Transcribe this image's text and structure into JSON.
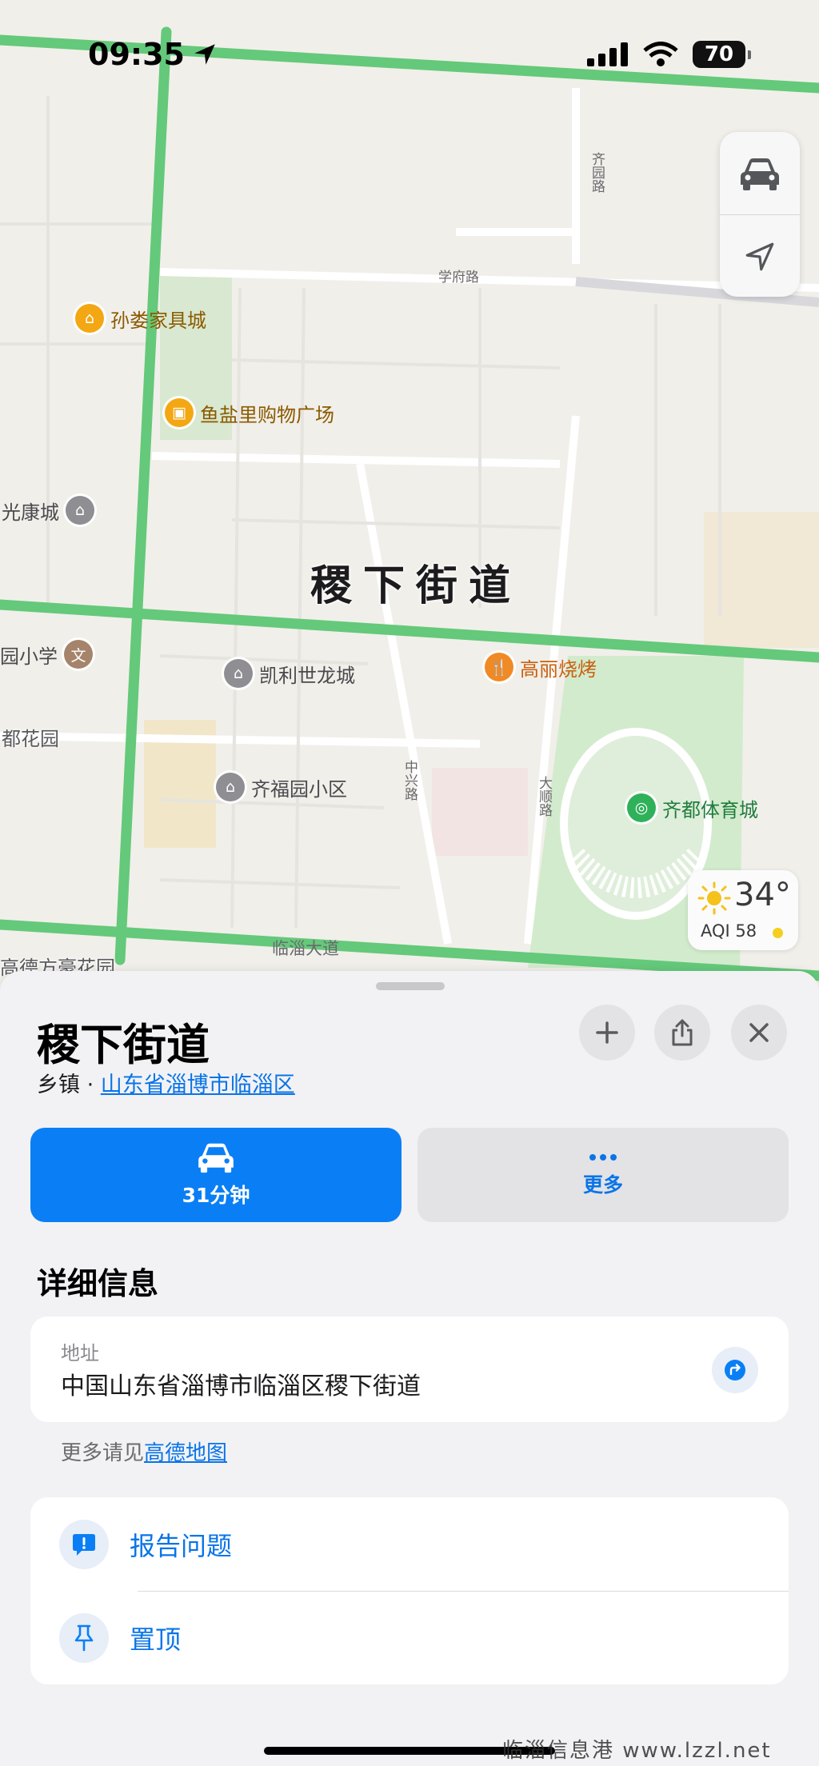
{
  "status_bar": {
    "time": "09:35",
    "battery": "70"
  },
  "map": {
    "district_label": "稷下街道",
    "pois": [
      {
        "name": "孙娄家具城",
        "icon": "furniture-icon",
        "color": "#f3a713"
      },
      {
        "name": "鱼盐里购物广场",
        "icon": "shopping-bag-icon",
        "color": "#f3a713"
      },
      {
        "name": "光康城",
        "icon": "residential-icon",
        "color": "#8e8e93"
      },
      {
        "name": "园小学",
        "icon": "school-icon",
        "color": "#a5846b"
      },
      {
        "name": "凯利世龙城",
        "icon": "residential-icon",
        "color": "#8e8e93"
      },
      {
        "name": "高丽烧烤",
        "icon": "restaurant-icon",
        "color": "#f08a24"
      },
      {
        "name": "齐福园小区",
        "icon": "residential-icon",
        "color": "#8e8e93"
      },
      {
        "name": "齐都体育城",
        "icon": "stadium-icon",
        "color": "#2fb15a"
      }
    ],
    "labels": {
      "area1": "都花园",
      "area2": "高德方豪花园",
      "road_xuefu": "学府路",
      "road_qiyuan": "齐园路",
      "road_zhongxing": "中兴路",
      "road_dashun": "大顺路",
      "road_linzi": "临淄大道"
    },
    "weather": {
      "temperature": "34°",
      "aqi": "AQI 58"
    }
  },
  "sheet": {
    "title": "稷下街道",
    "category": "乡镇",
    "separator": "·",
    "region_link": "山东省淄博市临淄区",
    "drive_time": "31分钟",
    "more_label": "更多",
    "details_title": "详细信息",
    "address_label": "地址",
    "address_value": "中国山东省淄博市临淄区稷下街道",
    "more_info_prefix": "更多请见",
    "more_info_link": "高德地图",
    "report_label": "报告问题",
    "pin_label": "置顶"
  },
  "watermark": "临淄信息港 www.lzzl.net",
  "colors": {
    "accent": "#0a7ff5",
    "link": "#0a74e8",
    "road_green": "#64c97a"
  }
}
